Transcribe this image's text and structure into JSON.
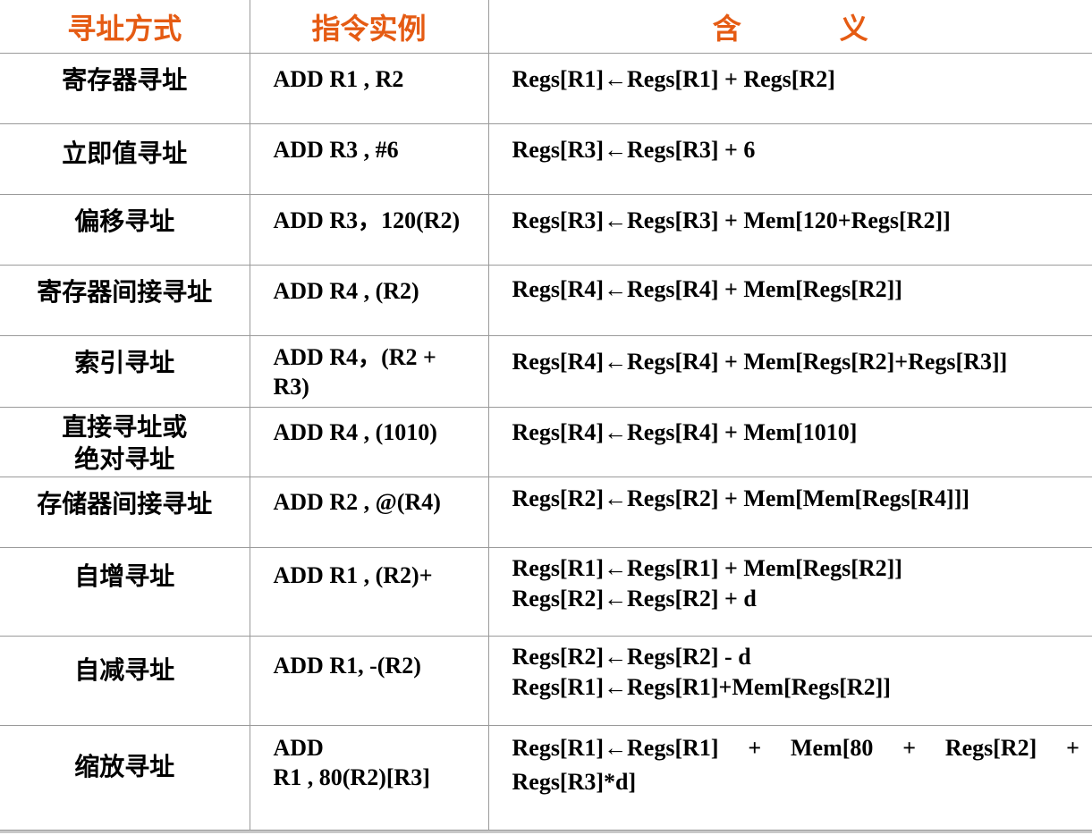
{
  "header": {
    "col_mode": "寻址方式",
    "col_example": "指令实例",
    "col_meaning_1": "含",
    "col_meaning_2": "义"
  },
  "rows": [
    {
      "mode": [
        "寄存器寻址"
      ],
      "example": [
        "ADD R1 , R2"
      ],
      "meaning": [
        "Regs[R1]←Regs[R1] + Regs[R2]"
      ]
    },
    {
      "mode": [
        "立即值寻址"
      ],
      "example": [
        "ADD R3 , #6"
      ],
      "meaning": [
        "Regs[R3]←Regs[R3] + 6"
      ]
    },
    {
      "mode": [
        "偏移寻址"
      ],
      "example": [
        "ADD R3，120(R2)"
      ],
      "meaning": [
        "Regs[R3]←Regs[R3] + Mem[120+Regs[R2]]"
      ]
    },
    {
      "mode": [
        "寄存器间接寻址"
      ],
      "example": [
        "ADD R4 , (R2)"
      ],
      "meaning": [
        "Regs[R4]←Regs[R4] + Mem[Regs[R2]]"
      ]
    },
    {
      "mode": [
        "索引寻址"
      ],
      "example": [
        "ADD R4，(R2 +",
        "R3)"
      ],
      "meaning": [
        "Regs[R4]←Regs[R4] + Mem[Regs[R2]+Regs[R3]]"
      ]
    },
    {
      "mode": [
        "直接寻址或",
        "绝对寻址"
      ],
      "example": [
        "ADD R4 , (1010)"
      ],
      "meaning": [
        "Regs[R4]←Regs[R4] + Mem[1010]"
      ]
    },
    {
      "mode": [
        "存储器间接寻址"
      ],
      "example": [
        "ADD R2 , @(R4)"
      ],
      "meaning": [
        "Regs[R2]←Regs[R2] + Mem[Mem[Regs[R4]]]"
      ]
    },
    {
      "mode": [
        "自增寻址"
      ],
      "example": [
        "ADD R1 , (R2)+"
      ],
      "meaning": [
        "Regs[R1]←Regs[R1] + Mem[Regs[R2]]",
        "Regs[R2]←Regs[R2] + d"
      ]
    },
    {
      "mode": [
        "自减寻址"
      ],
      "example": [
        "ADD R1, -(R2)"
      ],
      "meaning": [
        "Regs[R2]←Regs[R2] - d",
        "Regs[R1]←Regs[R1]+Mem[Regs[R2]]"
      ]
    },
    {
      "mode": [
        "缩放寻址"
      ],
      "example": [
        "ADD",
        "R1 , 80(R2)[R3]"
      ],
      "meaning": [
        "Regs[R1]←Regs[R1]",
        "+",
        "Mem[80",
        "+",
        "Regs[R2]",
        "+",
        "Regs[R3]*d]"
      ]
    }
  ]
}
